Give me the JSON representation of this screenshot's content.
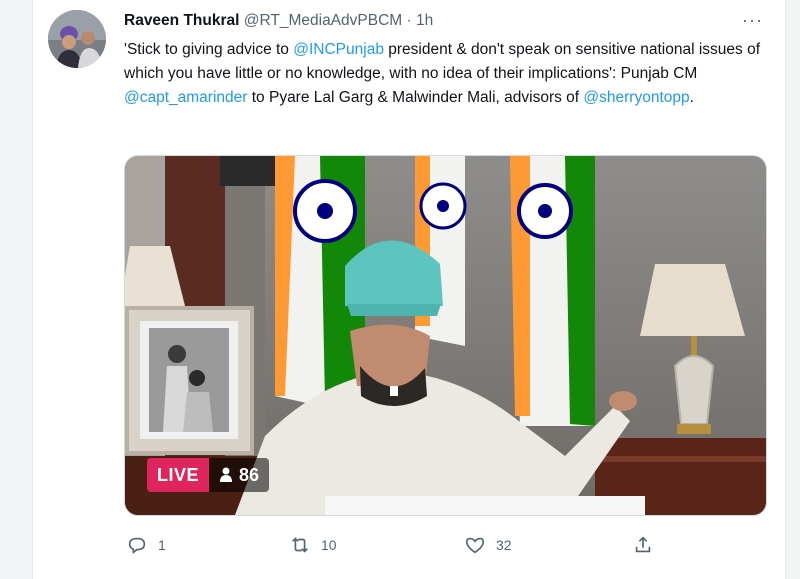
{
  "tweet": {
    "author_name": "Raveen Thukral",
    "author_handle": "@RT_MediaAdvPBCM",
    "separator": "·",
    "time": "1h",
    "more_label": "···",
    "text_parts": [
      {
        "type": "text",
        "value": "'Stick to giving advice to "
      },
      {
        "type": "mention",
        "value": "@INCPunjab"
      },
      {
        "type": "text",
        "value": " president & don't speak on sensitive national issues of which you have little or no knowledge, with no idea of their implications': Punjab CM "
      },
      {
        "type": "mention",
        "value": "@capt_amarinder"
      },
      {
        "type": "text",
        "value": " to Pyare Lal Garg & Malwinder Mali, advisors of "
      },
      {
        "type": "mention",
        "value": "@sherryontopp"
      },
      {
        "type": "text",
        "value": "."
      }
    ]
  },
  "media": {
    "live_label": "LIVE",
    "viewer_count": "86",
    "viewer_icon": "person-icon"
  },
  "actions": {
    "reply_count": "1",
    "retweet_count": "10",
    "like_count": "32",
    "reply_icon": "reply-icon",
    "retweet_icon": "retweet-icon",
    "like_icon": "heart-icon",
    "share_icon": "share-icon"
  },
  "colors": {
    "link": "#1d9bf0",
    "live_badge": "#e0245e",
    "muted": "#536471"
  }
}
